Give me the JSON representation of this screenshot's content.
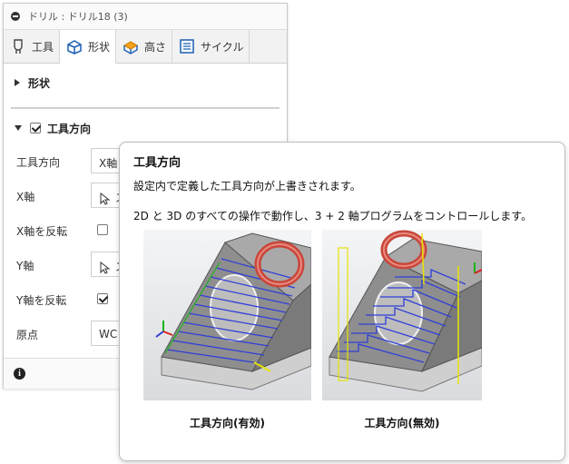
{
  "dialog": {
    "title": "ドリル : ドリル18 (3)",
    "tabs": [
      {
        "label": "工具",
        "icon": "tool-icon"
      },
      {
        "label": "形状",
        "icon": "shape-icon"
      },
      {
        "label": "高さ",
        "icon": "height-icon"
      },
      {
        "label": "サイクル",
        "icon": "cycle-icon"
      }
    ],
    "sections": {
      "shape": {
        "label": "形状",
        "expanded": false
      },
      "tool_orientation": {
        "label": "工具方向",
        "checked": true,
        "expanded": true
      }
    },
    "rows": [
      {
        "label": "工具方向",
        "value": "X軸"
      },
      {
        "label": "X軸",
        "value": "ス"
      },
      {
        "label": "X軸を反転",
        "checked": false
      },
      {
        "label": "Y軸",
        "value": "ス"
      },
      {
        "label": "Y軸を反転",
        "checked": true
      },
      {
        "label": "原点",
        "value": "WC"
      }
    ],
    "footer_icon": "info-icon"
  },
  "tooltip": {
    "title": "工具方向",
    "line1": "設定内で定義した工具方向が上書きされます。",
    "line2": "2D と 3D のすべての操作で動作し、3 + 2 軸プログラムをコントロールします。",
    "images": [
      {
        "caption": "工具方向(有効)"
      },
      {
        "caption": "工具方向(無効)"
      }
    ]
  },
  "colors": {
    "toolpath_blue": "#2f3fd8",
    "part_gray": "#8c8c8c",
    "ring_red": "#c9463a",
    "axis_yellow": "#e7e400",
    "axis_green": "#19b419"
  }
}
